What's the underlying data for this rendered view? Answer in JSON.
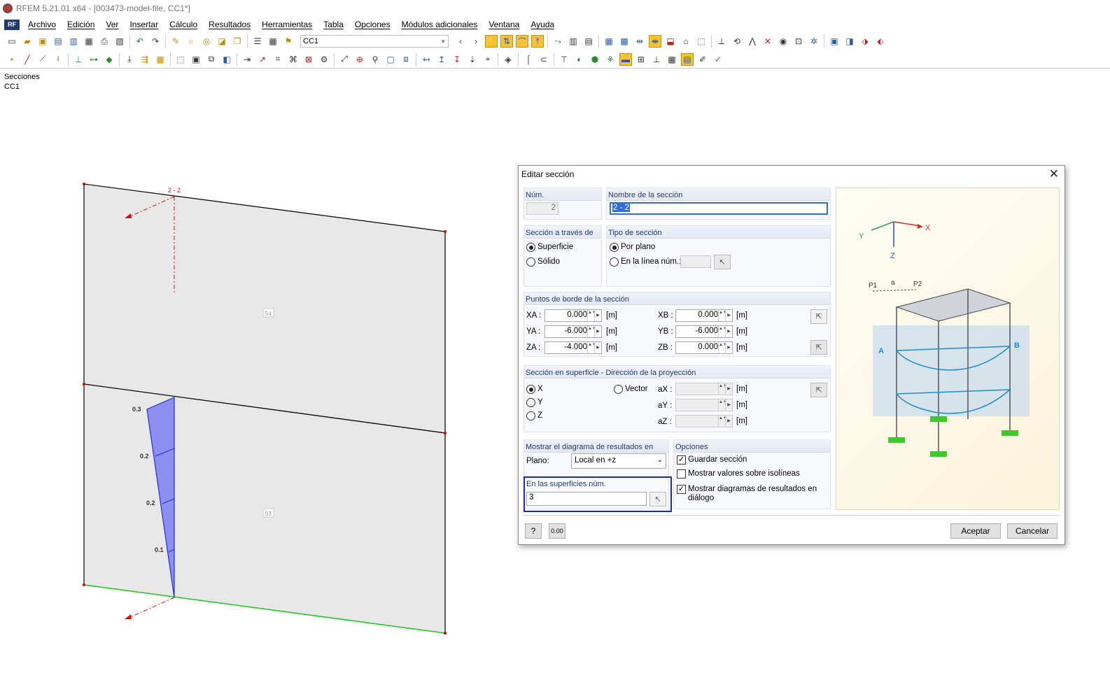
{
  "window": {
    "title": "RFEM 5.21.01 x64 - [003473-model-file, CC1*]"
  },
  "menu": [
    "Archivo",
    "Edición",
    "Ver",
    "Insertar",
    "Cálculo",
    "Resultados",
    "Herramientas",
    "Tabla",
    "Opciones",
    "Módulos adicionales",
    "Ventana",
    "Ayuda"
  ],
  "toolbar": {
    "load_case": "CC1"
  },
  "view": {
    "title_line1": "Secciones",
    "title_line2": "CC1",
    "section_name": "2 - 2",
    "surface_upper": "S4",
    "surface_lower": "S3",
    "diagram_values": [
      "0.3",
      "0.2",
      "0.2",
      "0.1"
    ]
  },
  "dialog": {
    "title": "Editar sección",
    "num": {
      "label": "Núm.",
      "value": "2"
    },
    "name": {
      "label": "Nombre de la sección",
      "value": "2 - 2"
    },
    "section_through": {
      "label": "Sección a través de",
      "options": [
        "Superficie",
        "Sólido"
      ],
      "selected": "Superficie"
    },
    "section_type": {
      "label": "Tipo de sección",
      "opt_plane": "Por plano",
      "opt_line": "En la línea núm.:",
      "selected": "Por plano"
    },
    "border_points": {
      "label": "Puntos de borde de la sección",
      "unit": "[m]",
      "xa": {
        "label": "XA :",
        "value": "0.000"
      },
      "ya": {
        "label": "YA :",
        "value": "-6.000"
      },
      "za": {
        "label": "ZA :",
        "value": "-4.000"
      },
      "xb": {
        "label": "XB :",
        "value": "0.000"
      },
      "yb": {
        "label": "YB :",
        "value": "-6.000"
      },
      "zb": {
        "label": "ZB :",
        "value": "0.000"
      }
    },
    "projection": {
      "label": "Sección en superficie - Dirección de la proyección",
      "options": [
        "X",
        "Y",
        "Z"
      ],
      "selected": "X",
      "vector_label": "Vector",
      "ax_label": "aX :",
      "ay_label": "aY :",
      "az_label": "aZ :",
      "unit": "[m]"
    },
    "diagram": {
      "label": "Mostrar el diagrama de resultados en",
      "plane_label": "Plano:",
      "plane_value": "Local en +z"
    },
    "surfaces": {
      "label": "En las superficies núm.",
      "value": "3"
    },
    "options": {
      "label": "Opciones",
      "save_section": {
        "label": "Guardar sección",
        "checked": true
      },
      "show_values": {
        "label": "Mostrar valores sobre isolíneas",
        "checked": false
      },
      "show_diagrams": {
        "label1": "Mostrar diagramas de resultados en",
        "label2": "diálogo",
        "checked": true
      }
    },
    "buttons": {
      "ok": "Aceptar",
      "cancel": "Cancelar",
      "units": "0.00"
    },
    "illustration": {
      "x": "X",
      "y": "Y",
      "z": "Z",
      "p1": "P1",
      "p2": "P2",
      "a": "a",
      "pa": "A",
      "pb": "B"
    }
  },
  "colors": {
    "section_line": "#d01010",
    "diagram_fill": "#8c8ff0",
    "diagram_stroke": "#1f2fd6",
    "support_line": "#22cc22",
    "highlight": "#1a2ac8"
  }
}
